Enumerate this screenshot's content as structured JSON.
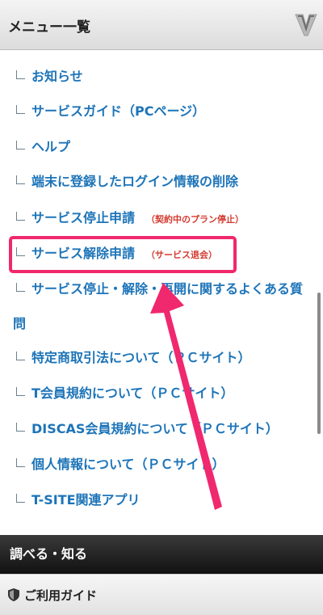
{
  "header": {
    "title": "メニュー一覧",
    "toggle_icon": "chevron-down-icon"
  },
  "menu": {
    "items": [
      {
        "label": "お知らせ"
      },
      {
        "label": "サービスガイド（PCページ）"
      },
      {
        "label": "ヘルプ"
      },
      {
        "label": "端末に登録したログイン情報の削除"
      },
      {
        "label": "サービス停止申請",
        "note": "（契約中のプラン停止）"
      },
      {
        "label": "サービス解除申請",
        "note": "（サービス退会）"
      },
      {
        "label": "サービス停止・解除・再開に関するよくある質",
        "label_cont": "問"
      },
      {
        "label": "特定商取引法について（ＰＣサイト）"
      },
      {
        "label": "T会員規約について（ＰＣサイト）"
      },
      {
        "label": "DISCAS会員規約について（ＰＣサイト）"
      },
      {
        "label": "個人情報について（ＰＣサイト）"
      },
      {
        "label": "T-SITE関連アプリ"
      }
    ]
  },
  "section_header": {
    "label": "調べる・知る"
  },
  "guide": {
    "label": "ご利用ガイド",
    "icon": "shield-icon"
  },
  "colors": {
    "link": "#1d74b8",
    "note": "#d33a2f",
    "highlight": "#f0286e",
    "arrow": "#f0286e"
  }
}
